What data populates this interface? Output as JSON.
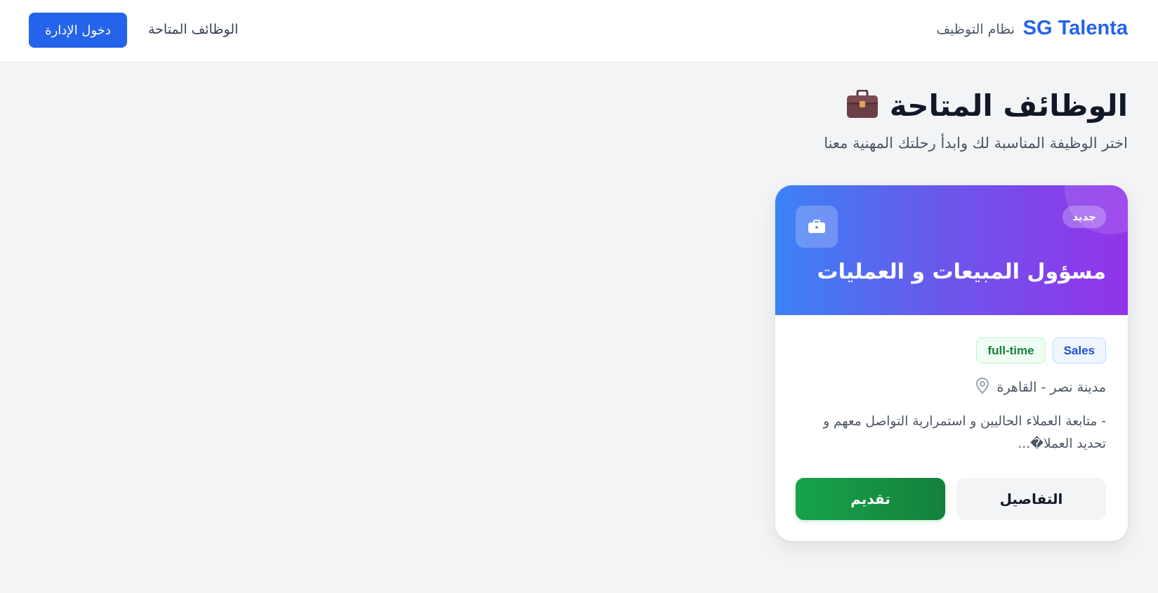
{
  "nav": {
    "brand": "SG Talenta",
    "subtitle": "نظام التوظيف",
    "jobs_link": "الوظائف المتاحة",
    "admin_button": "دخول الإدارة"
  },
  "page": {
    "title": "الوظائف المتاحة",
    "title_icon": "briefcase-icon",
    "subtitle": "اختر الوظيفة المناسبة لك وابدأ رحلتك المهنية معنا"
  },
  "jobs": [
    {
      "badge": "جديد",
      "icon": "briefcase-icon",
      "title": "مسؤول المبيعات و العمليات",
      "department": "Sales",
      "type": "full-time",
      "location_icon": "map-pin-icon",
      "location": "مدينة نصر - القاهرة",
      "description": "- متابعة العملاء الحاليين و استمرارية التواصل معهم و تحديد العملا�...",
      "details_button": "التفاصيل",
      "apply_button": "تقديم"
    }
  ],
  "colors": {
    "primary": "#2563eb",
    "header_gradient_start": "#3b82f6",
    "header_gradient_end": "#9333ea",
    "apply_green": "#16a34a",
    "background": "#f3f4f6"
  }
}
